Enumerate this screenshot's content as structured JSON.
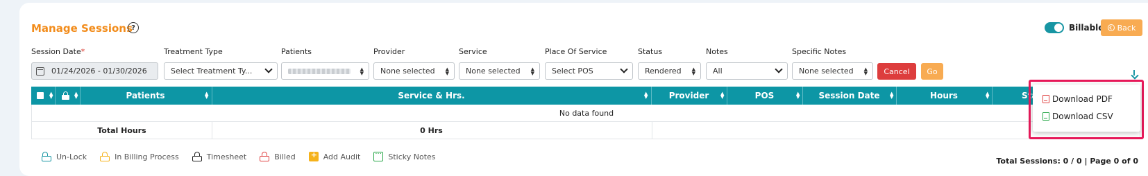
{
  "header": {
    "title": "Manage Sessions",
    "help_glyph": "?",
    "billable_label": "Billable",
    "back_label": "Back"
  },
  "filters": {
    "session_date": {
      "label": "Session Date",
      "required_mark": "*",
      "value": "01/24/2026 - 01/30/2026"
    },
    "treatment_type": {
      "label": "Treatment Type",
      "value": "Select Treatment Ty..."
    },
    "patients": {
      "label": "Patients"
    },
    "provider": {
      "label": "Provider",
      "value": "None selected"
    },
    "service": {
      "label": "Service",
      "value": "None selected"
    },
    "place_of_service": {
      "label": "Place Of Service",
      "value": "Select POS"
    },
    "status": {
      "label": "Status",
      "value": "Rendered"
    },
    "notes": {
      "label": "Notes",
      "value": "All"
    },
    "specific_notes": {
      "label": "Specific Notes",
      "value": "None selected"
    },
    "cancel_label": "Cancel",
    "go_label": "Go"
  },
  "table": {
    "columns": [
      "Patients",
      "Service & Hrs.",
      "Provider",
      "POS",
      "Session Date",
      "Hours",
      "Status"
    ],
    "empty_message": "No data found",
    "total_hours_label": "Total Hours",
    "total_hours_value": "0 Hrs"
  },
  "legend": [
    {
      "label": "Un-Lock",
      "icon": "unlock-icon",
      "color": "#1795a3"
    },
    {
      "label": "In Billing Process",
      "icon": "lock-icon",
      "color": "#f5b21b"
    },
    {
      "label": "Timesheet",
      "icon": "lock-icon",
      "color": "#222222"
    },
    {
      "label": "Billed",
      "icon": "lock-icon",
      "color": "#e04444"
    },
    {
      "label": "Add Audit",
      "icon": "add-audit-icon",
      "color": "#f5b21b"
    },
    {
      "label": "Sticky Notes",
      "icon": "sticky-notes-icon",
      "color": "#2aa84a"
    }
  ],
  "footer": {
    "total_sessions": "Total Sessions: 0 / 0 | Page 0 of 0"
  },
  "download_menu": {
    "pdf_label": "Download PDF",
    "csv_label": "Download CSV"
  },
  "colors": {
    "accent_orange": "#f28c1b",
    "teal": "#0d96a5",
    "cancel_red": "#dd3d3d",
    "highlight": "#e8195a"
  }
}
